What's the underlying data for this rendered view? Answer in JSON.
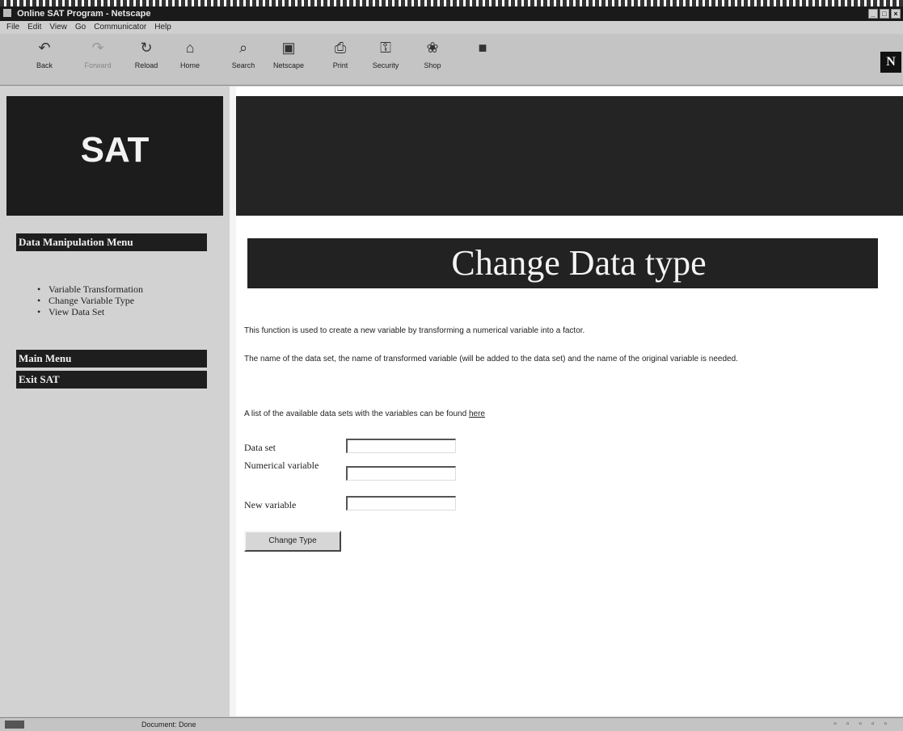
{
  "window": {
    "title": "Online SAT Program - Netscape",
    "controls": [
      "_",
      "□",
      "×"
    ]
  },
  "menubar": [
    "File",
    "Edit",
    "View",
    "Go",
    "Communicator",
    "Help"
  ],
  "toolbar": {
    "buttons": [
      {
        "label": "Back",
        "icon": "back-arrow-icon",
        "glyph": "↶",
        "enabled": true
      },
      {
        "label": "Forward",
        "icon": "forward-arrow-icon",
        "glyph": "↷",
        "enabled": false
      },
      {
        "label": "Reload",
        "icon": "reload-icon",
        "glyph": "↻",
        "enabled": true
      },
      {
        "label": "Home",
        "icon": "home-icon",
        "glyph": "⌂",
        "enabled": true
      },
      {
        "label": "Search",
        "icon": "search-icon",
        "glyph": "⌕",
        "enabled": true
      },
      {
        "label": "Netscape",
        "icon": "netscape-icon",
        "glyph": "▣",
        "enabled": true
      },
      {
        "label": "Print",
        "icon": "print-icon",
        "glyph": "⎙",
        "enabled": true
      },
      {
        "label": "Security",
        "icon": "lock-icon",
        "glyph": "⚿",
        "enabled": true
      },
      {
        "label": "Shop",
        "icon": "shop-icon",
        "glyph": "❀",
        "enabled": true
      },
      {
        "label": "",
        "icon": "stop-icon",
        "glyph": "■",
        "enabled": true
      }
    ],
    "logo": "N"
  },
  "sidebar": {
    "logo": "SAT",
    "data_menu_heading": "Data Manipulation Menu",
    "data_menu_items": [
      "Variable Transformation",
      "Change Variable Type",
      "View Data Set"
    ],
    "main_menu": "Main Menu",
    "exit": "Exit SAT"
  },
  "main": {
    "title": "Change Data type",
    "description": "This function is used to create a new variable by transforming a numerical variable into a factor.",
    "instructions": "The name of the data set, the name of transformed variable (will be added to the data set) and the name of the original variable is needed.",
    "list_text": "A list of the available data sets with the variables can be found ",
    "list_link": "here",
    "form": {
      "data_set_label": "Data set",
      "numerical_label": "Numerical variable",
      "new_variable_label": "New variable",
      "data_set_value": "",
      "numerical_value": "",
      "new_variable_value": ""
    },
    "submit_label": "Change Type"
  },
  "statusbar": {
    "text": "Document: Done"
  }
}
